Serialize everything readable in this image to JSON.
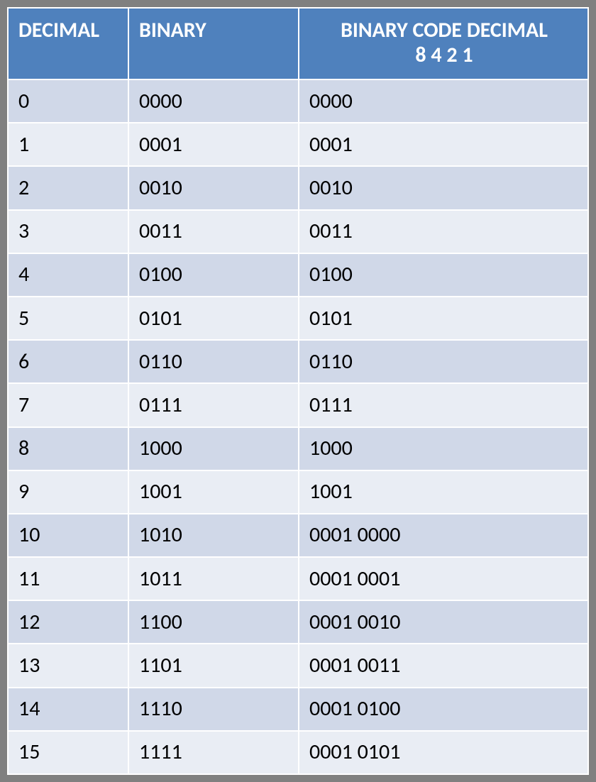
{
  "headers": {
    "decimal": "DECIMAL",
    "binary": "BINARY",
    "bcd_line1": "BINARY CODE DECIMAL",
    "bcd_line2": "8 4 2 1"
  },
  "rows": [
    {
      "decimal": "0",
      "binary": "0000",
      "bcd": "0000"
    },
    {
      "decimal": "1",
      "binary": "0001",
      "bcd": "0001"
    },
    {
      "decimal": "2",
      "binary": "0010",
      "bcd": "0010"
    },
    {
      "decimal": "3",
      "binary": "0011",
      "bcd": "0011"
    },
    {
      "decimal": "4",
      "binary": "0100",
      "bcd": "0100"
    },
    {
      "decimal": "5",
      "binary": "0101",
      "bcd": "0101"
    },
    {
      "decimal": "6",
      "binary": "0110",
      "bcd": "0110"
    },
    {
      "decimal": "7",
      "binary": "0111",
      "bcd": "0111"
    },
    {
      "decimal": "8",
      "binary": "1000",
      "bcd": "1000"
    },
    {
      "decimal": "9",
      "binary": "1001",
      "bcd": "1001"
    },
    {
      "decimal": "10",
      "binary": "1010",
      "bcd": "0001 0000"
    },
    {
      "decimal": "11",
      "binary": "1011",
      "bcd": "0001 0001"
    },
    {
      "decimal": "12",
      "binary": "1100",
      "bcd": "0001 0010"
    },
    {
      "decimal": "13",
      "binary": "1101",
      "bcd": "0001 0011"
    },
    {
      "decimal": "14",
      "binary": "1110",
      "bcd": "0001 0100"
    },
    {
      "decimal": "15",
      "binary": "1111",
      "bcd": "0001 0101"
    }
  ],
  "chart_data": {
    "type": "table",
    "columns": [
      "DECIMAL",
      "BINARY",
      "BINARY CODE DECIMAL 8 4 2 1"
    ],
    "rows": [
      [
        "0",
        "0000",
        "0000"
      ],
      [
        "1",
        "0001",
        "0001"
      ],
      [
        "2",
        "0010",
        "0010"
      ],
      [
        "3",
        "0011",
        "0011"
      ],
      [
        "4",
        "0100",
        "0100"
      ],
      [
        "5",
        "0101",
        "0101"
      ],
      [
        "6",
        "0110",
        "0110"
      ],
      [
        "7",
        "0111",
        "0111"
      ],
      [
        "8",
        "1000",
        "1000"
      ],
      [
        "9",
        "1001",
        "1001"
      ],
      [
        "10",
        "1010",
        "0001 0000"
      ],
      [
        "11",
        "1011",
        "0001 0001"
      ],
      [
        "12",
        "1100",
        "0001 0010"
      ],
      [
        "13",
        "1101",
        "0001 0011"
      ],
      [
        "14",
        "1110",
        "0001 0100"
      ],
      [
        "15",
        "1111",
        "0001 0101"
      ]
    ]
  }
}
